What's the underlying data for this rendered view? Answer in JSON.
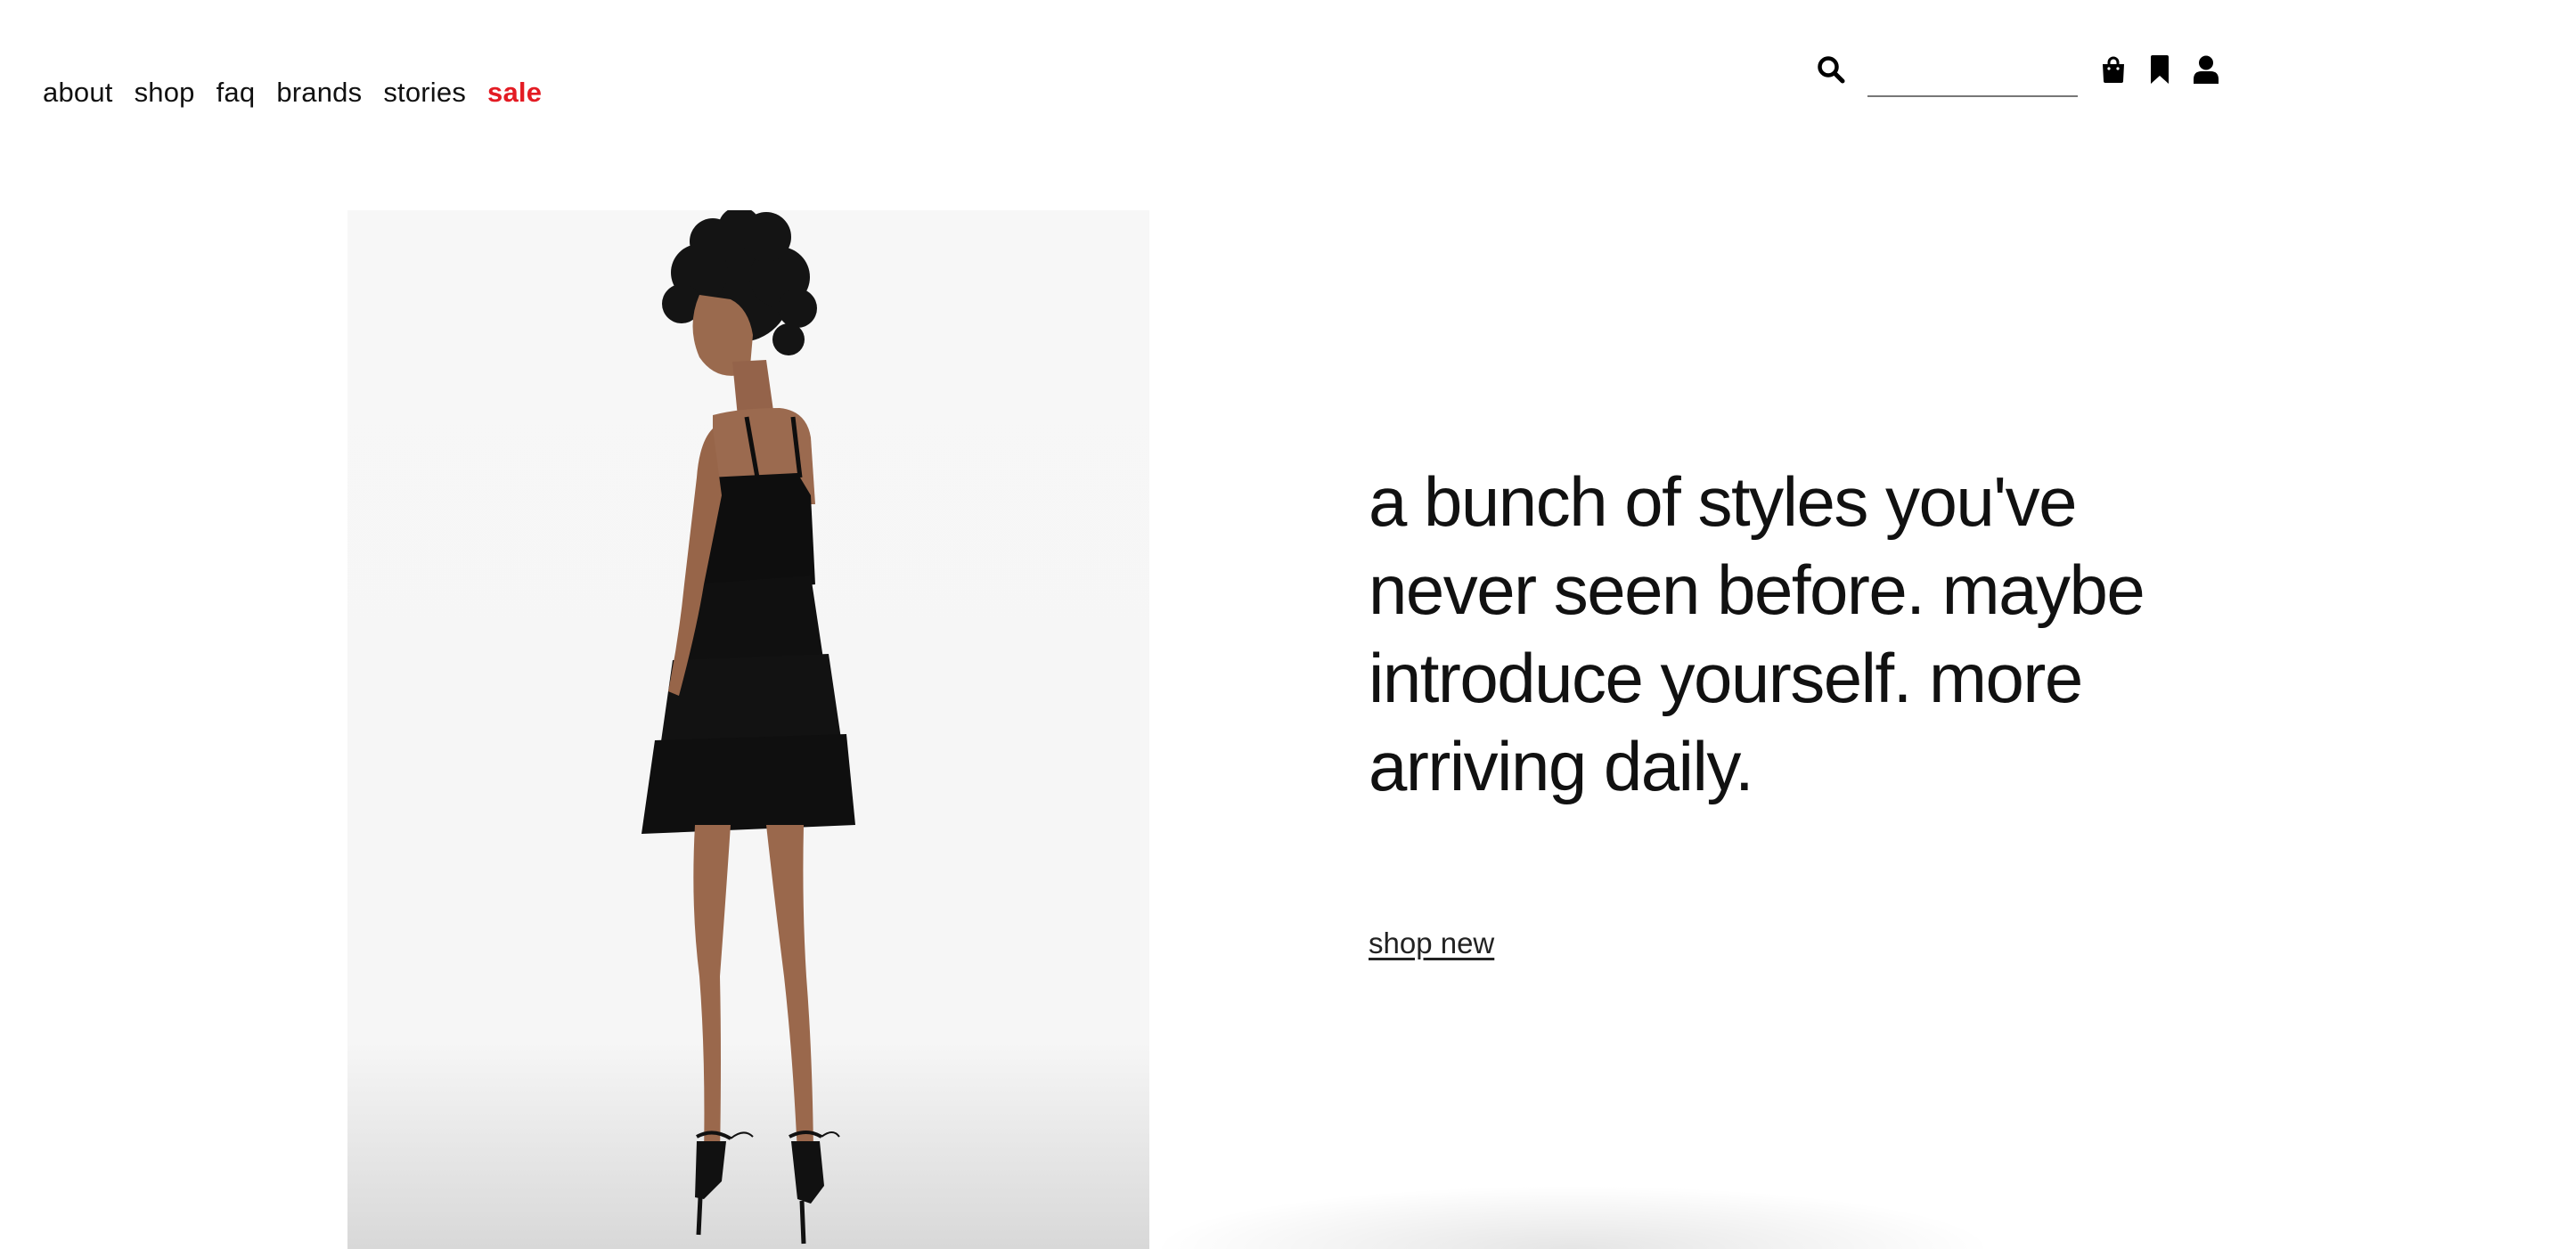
{
  "nav": {
    "items": [
      {
        "label": "about"
      },
      {
        "label": "shop"
      },
      {
        "label": "faq"
      },
      {
        "label": "brands"
      },
      {
        "label": "stories"
      },
      {
        "label": "sale",
        "color": "#e31b23"
      }
    ]
  },
  "utility": {
    "search_placeholder": "",
    "icons": [
      "search-icon",
      "shopping-bag-icon",
      "bookmark-icon",
      "account-icon"
    ]
  },
  "hero": {
    "headline": "a bunch of styles you've never seen before. maybe introduce yourself. more arriving daily.",
    "cta": "shop new",
    "image_alt": "model in black tiered mini dress"
  },
  "colors": {
    "accent_sale": "#e31b23",
    "text": "#111111",
    "image_bg": "#f7f7f7"
  }
}
